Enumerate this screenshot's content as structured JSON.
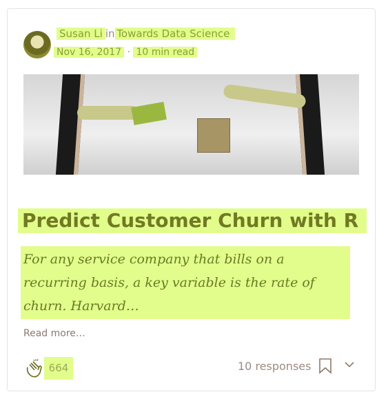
{
  "author": {
    "name": "Susan Li",
    "in": "in",
    "publication": "Towards Data Science",
    "date": "Nov 16, 2017",
    "separator": "·",
    "read_time": "10 min read"
  },
  "post": {
    "title": "Predict Customer Churn with R",
    "excerpt": "For any service company that bills on a recurring basis, a key variable is the rate of churn. Harvard…",
    "read_more": "Read more…"
  },
  "footer": {
    "claps": "664",
    "responses": "10 responses",
    "clap_icon": "clap-icon",
    "bookmark_icon": "bookmark-icon",
    "chevron_icon": "chevron-down-icon"
  },
  "colors": {
    "highlight": "#e2fd8b",
    "title": "#707a22"
  }
}
